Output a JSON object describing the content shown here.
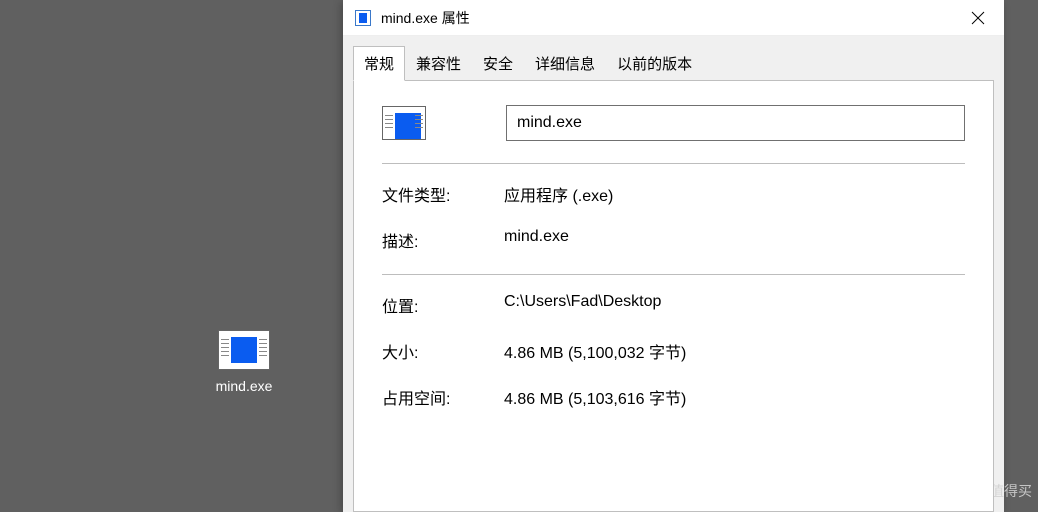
{
  "desktop": {
    "file_label": "mind.exe"
  },
  "window": {
    "title": "mind.exe 属性"
  },
  "tabs": {
    "general": "常规",
    "compatibility": "兼容性",
    "security": "安全",
    "details": "详细信息",
    "previous_versions": "以前的版本"
  },
  "general": {
    "filename": "mind.exe",
    "labels": {
      "file_type": "文件类型:",
      "description": "描述:",
      "location": "位置:",
      "size": "大小:",
      "size_on_disk": "占用空间:"
    },
    "values": {
      "file_type": "应用程序 (.exe)",
      "description": "mind.exe",
      "location": "C:\\Users\\Fad\\Desktop",
      "size": "4.86 MB (5,100,032 字节)",
      "size_on_disk": "4.86 MB (5,103,616 字节)"
    }
  },
  "watermark": "什么值得买"
}
